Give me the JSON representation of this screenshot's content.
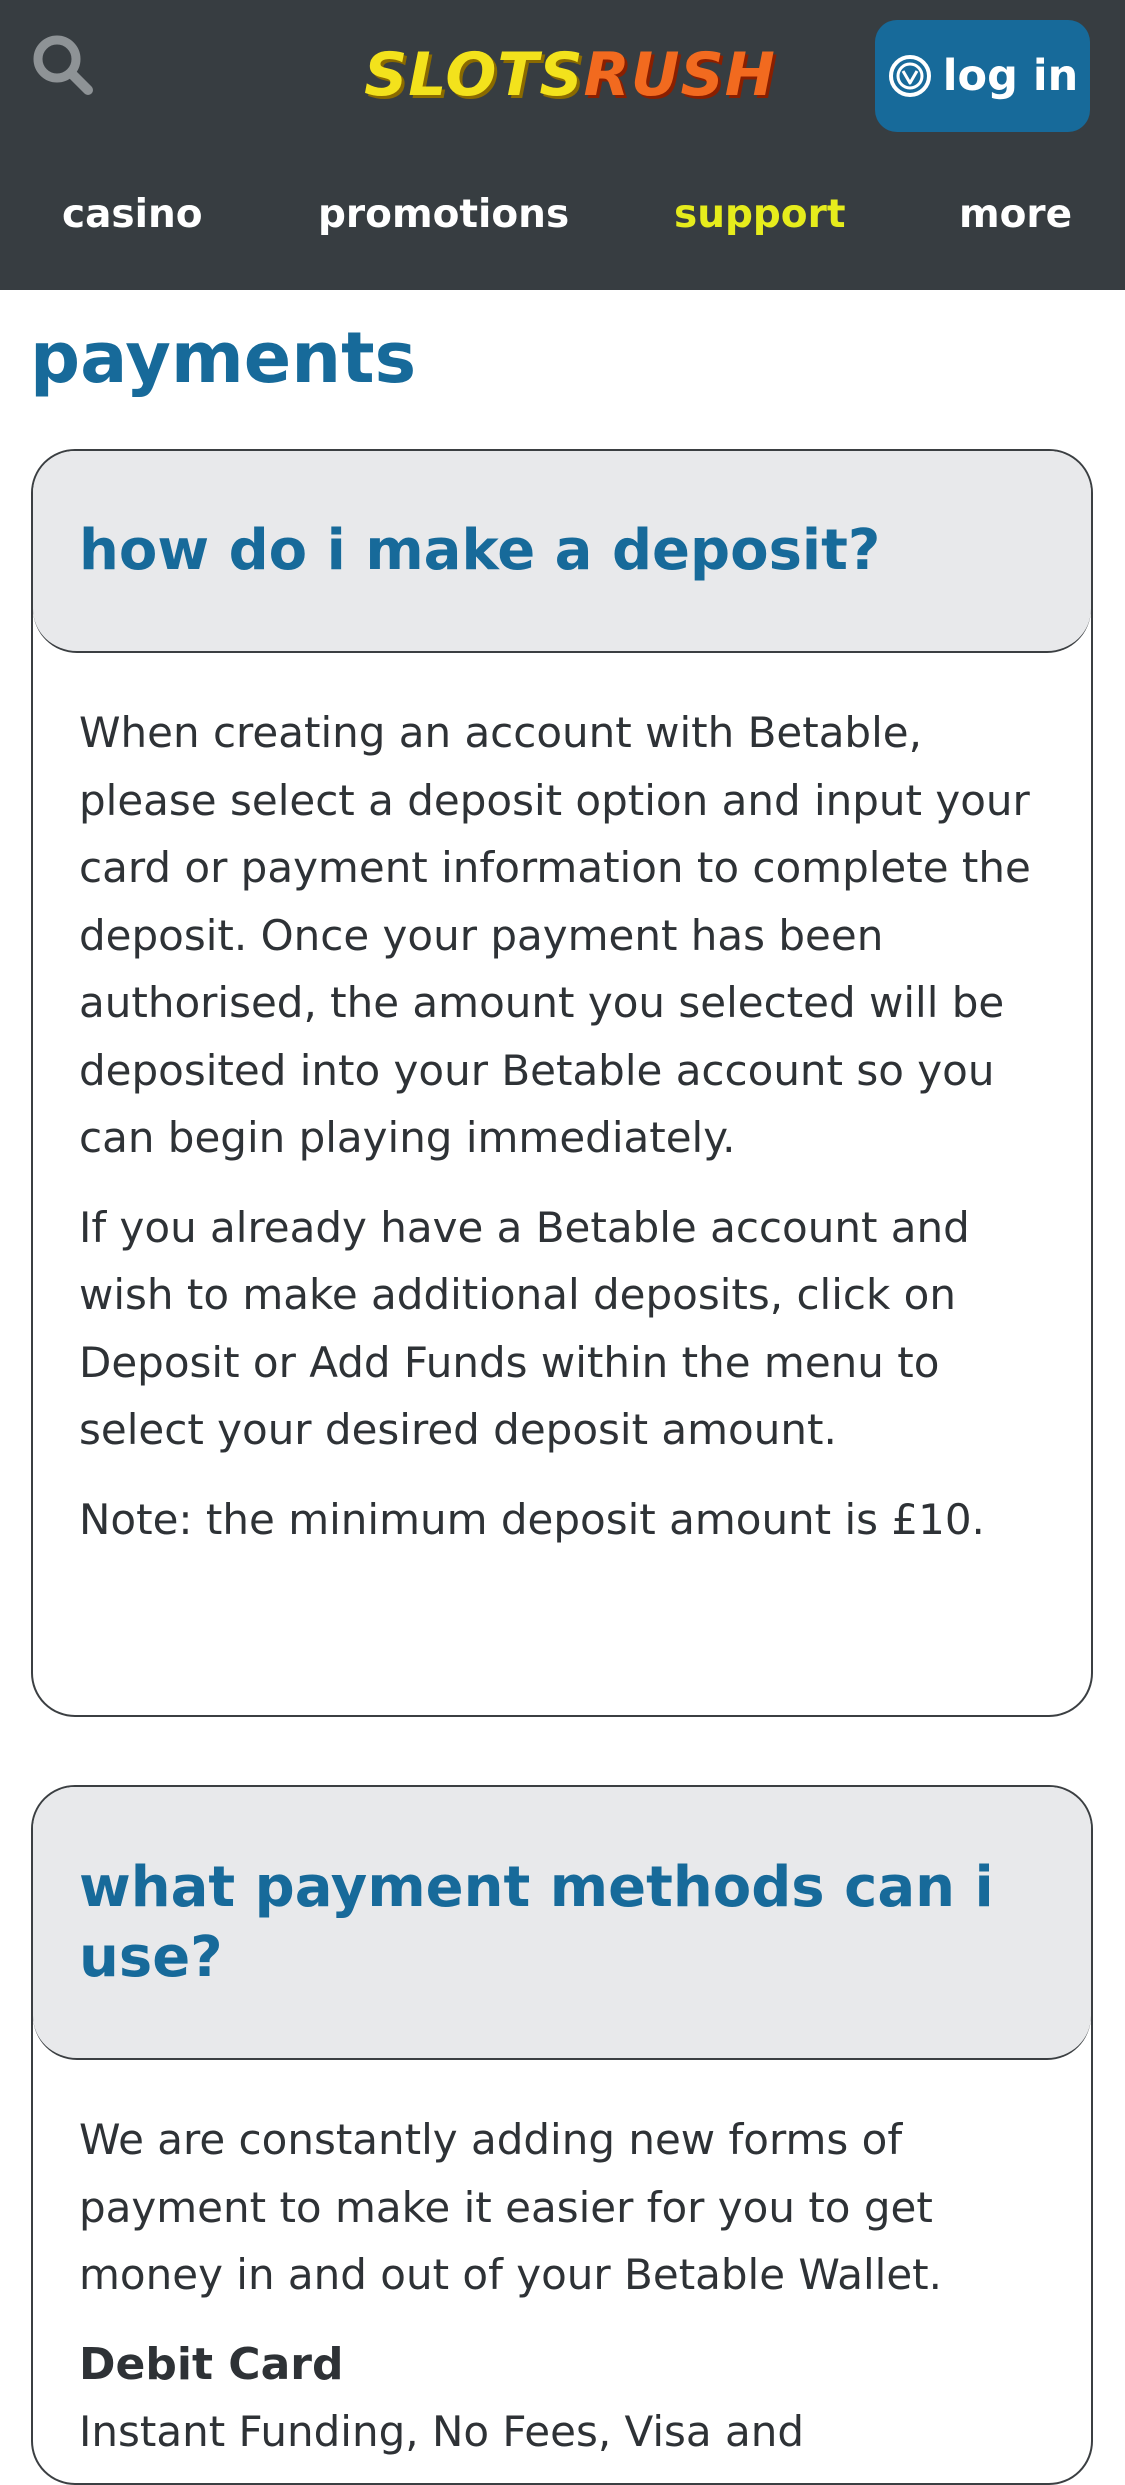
{
  "header": {
    "logo": {
      "part1": "SLOTS",
      "part2": "RUSH"
    },
    "login_label": "log in",
    "icons": {
      "search": "search-icon",
      "login": "wheel-icon"
    },
    "colors": {
      "background": "#373d41",
      "login_button": "#176a9a",
      "active_nav": "#e6ec1c"
    }
  },
  "nav": {
    "items": [
      {
        "label": "casino",
        "active": false
      },
      {
        "label": "promotions",
        "active": false
      },
      {
        "label": "support",
        "active": true
      },
      {
        "label": "more",
        "active": false
      }
    ]
  },
  "page": {
    "title": "payments",
    "colors": {
      "heading": "#176a9a",
      "card_header": "#e8e9eb"
    }
  },
  "faq": [
    {
      "question": "how do i make a deposit?",
      "paragraphs": [
        "When creating an account with Betable, please select a deposit option and input your card or payment information to complete the deposit. Once your payment has been authorised, the amount you selected will be deposited into your Betable account so you can begin playing immediately.",
        "If you already have a Betable account and wish to make additional deposits, click on Deposit or Add Funds within the menu to select your desired deposit amount.",
        "Note: the minimum deposit amount is £10."
      ]
    },
    {
      "question": "what payment methods can i use?",
      "paragraphs": [
        "We are constantly adding new forms of payment to make it easier for you to get money in and out of your Betable Wallet."
      ],
      "subheading": "Debit Card",
      "subtext": "Instant Funding, No Fees, Visa and"
    }
  ]
}
